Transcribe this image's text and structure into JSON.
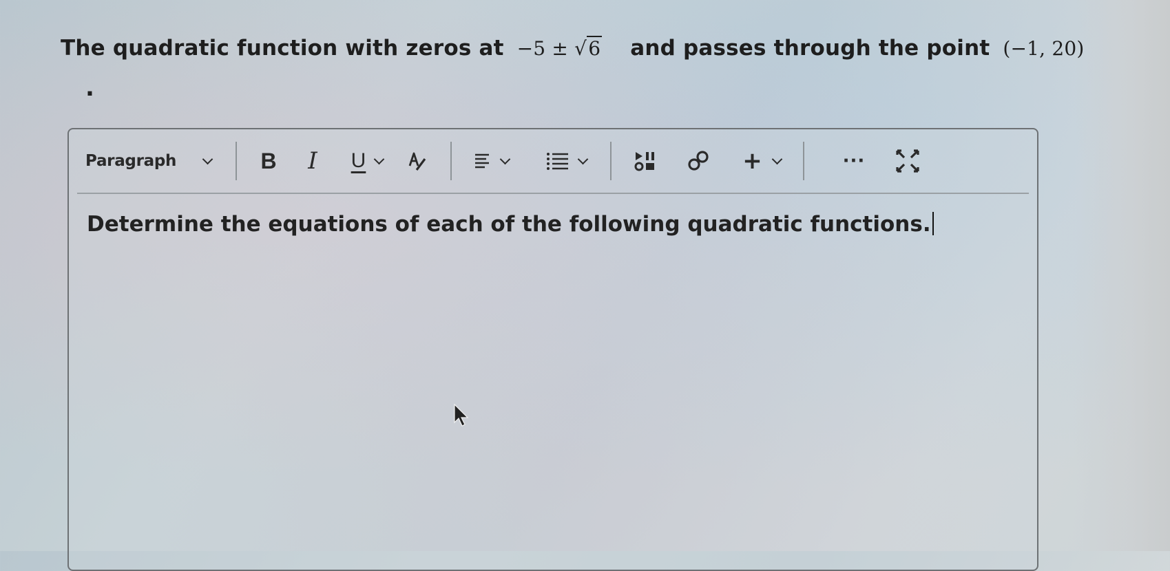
{
  "question": {
    "prefix": "The quadratic function with zeros at",
    "zeros_lead": "−5 ± ",
    "zeros_radicand": "6",
    "middle": "and passes through the point",
    "point": "(−1, 20)",
    "trailing": "."
  },
  "editor": {
    "toolbar": {
      "block_format": "Paragraph",
      "bold_label": "B",
      "italic_label": "I",
      "underline_label": "U",
      "insert_label": "+",
      "more_label": "···"
    },
    "content": "Determine the equations of each of the following quadratic functions."
  },
  "icons": [
    "chevron-down-icon",
    "text-color-icon",
    "align-icon",
    "list-icon",
    "media-icon",
    "link-icon",
    "more-icon",
    "fullscreen-icon",
    "mouse-pointer-icon"
  ]
}
